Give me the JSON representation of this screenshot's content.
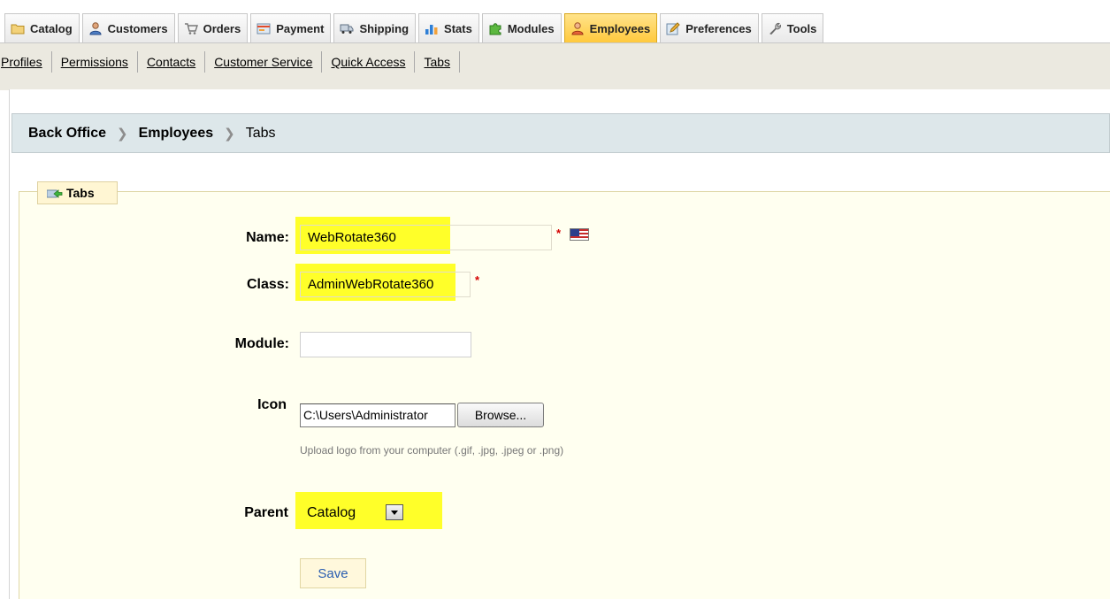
{
  "tabs": [
    {
      "label": "Catalog",
      "icon": "folder-icon",
      "active": false
    },
    {
      "label": "Customers",
      "icon": "user-icon",
      "active": false
    },
    {
      "label": "Orders",
      "icon": "cart-icon",
      "active": false
    },
    {
      "label": "Payment",
      "icon": "payment-icon",
      "active": false
    },
    {
      "label": "Shipping",
      "icon": "truck-icon",
      "active": false
    },
    {
      "label": "Stats",
      "icon": "chart-icon",
      "active": false
    },
    {
      "label": "Modules",
      "icon": "puzzle-icon",
      "active": false
    },
    {
      "label": "Employees",
      "icon": "employee-icon",
      "active": true
    },
    {
      "label": "Preferences",
      "icon": "pencil-icon",
      "active": false
    },
    {
      "label": "Tools",
      "icon": "wrench-icon",
      "active": false
    }
  ],
  "subnav": [
    {
      "label": "Profiles"
    },
    {
      "label": "Permissions"
    },
    {
      "label": "Contacts"
    },
    {
      "label": "Customer Service"
    },
    {
      "label": "Quick Access"
    },
    {
      "label": "Tabs"
    }
  ],
  "breadcrumb": {
    "root": "Back Office",
    "section": "Employees",
    "current": "Tabs"
  },
  "form": {
    "legend": "Tabs",
    "name_label": "Name:",
    "name_value": "WebRotate360",
    "class_label": "Class:",
    "class_value": "AdminWebRotate360",
    "module_label": "Module:",
    "module_value": "",
    "icon_label": "Icon",
    "icon_file_value": "C:\\Users\\Administrator",
    "browse_label": "Browse...",
    "icon_hint": "Upload logo from your computer (.gif, .jpg, .jpeg or .png)",
    "parent_label": "Parent",
    "parent_value": "Catalog",
    "save_label": "Save",
    "required_marker": "*"
  },
  "colors": {
    "highlight": "#ffff29",
    "active_tab": "#ffc93d",
    "breadcrumb_bg": "#dde7ea",
    "fieldset_bg": "#fffff0",
    "save_text": "#2a5db0"
  }
}
